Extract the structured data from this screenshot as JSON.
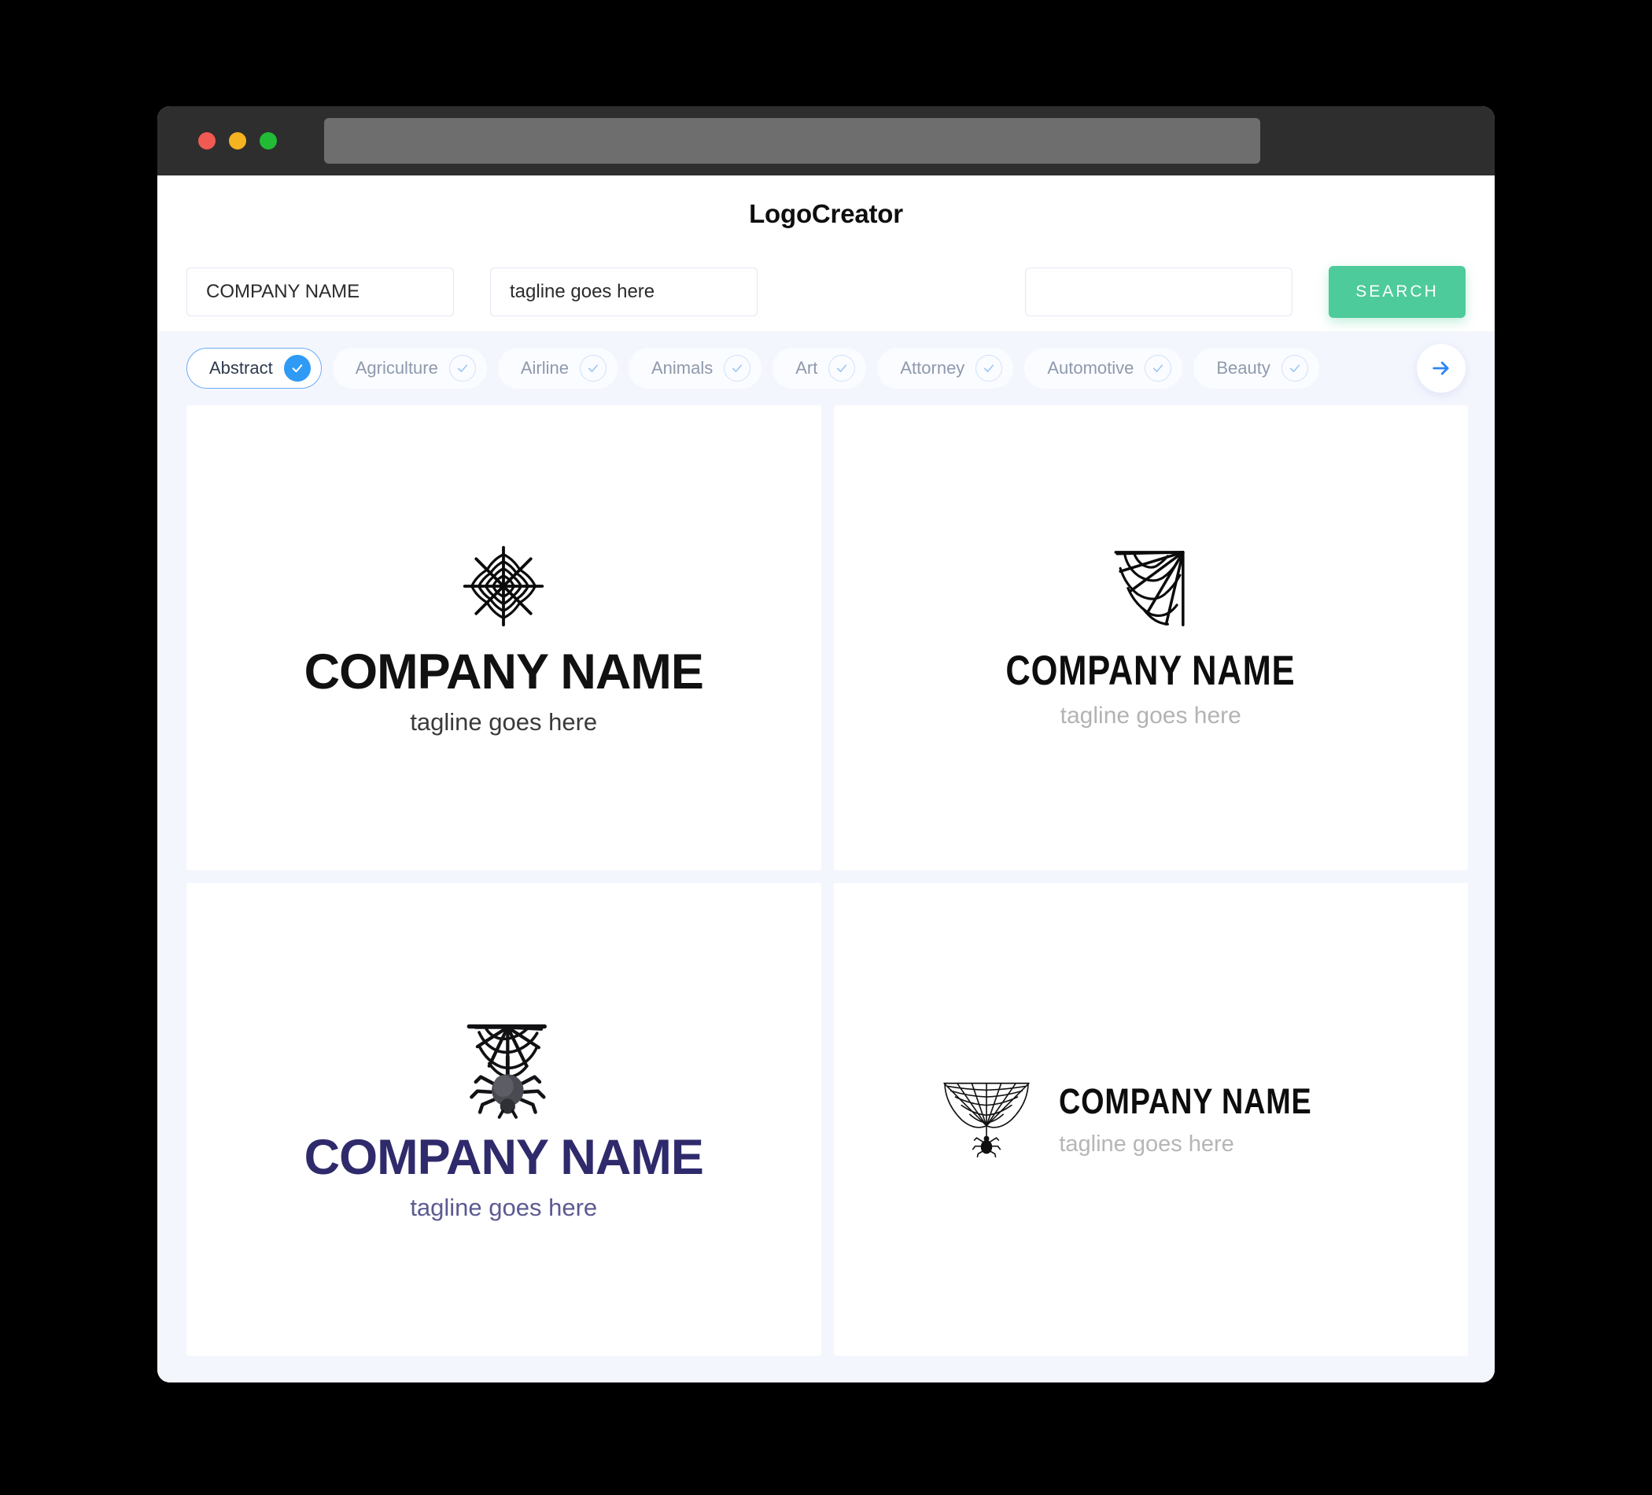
{
  "window": {
    "traffic_lights": [
      "close",
      "minimize",
      "maximize"
    ],
    "colors": {
      "close": "#f05a52",
      "minimize": "#f5b320",
      "maximize": "#22bb36",
      "titlebar": "#2e2e2e",
      "urlbar": "#6e6e6e",
      "page_bg": "#f4f6fe",
      "accent_green": "#4ecb9a",
      "accent_blue": "#2f9bf5",
      "navy": "#2e2a6b"
    }
  },
  "header": {
    "brand": "LogoCreator"
  },
  "search": {
    "company_value": "COMPANY NAME",
    "company_placeholder": "COMPANY NAME",
    "tagline_value": "tagline goes here",
    "tagline_placeholder": "tagline goes here",
    "extra_value": "",
    "extra_placeholder": "",
    "button_label": "SEARCH"
  },
  "categories": {
    "next_icon": "arrow-right-icon",
    "items": [
      {
        "label": "Abstract",
        "selected": true
      },
      {
        "label": "Agriculture",
        "selected": false
      },
      {
        "label": "Airline",
        "selected": false
      },
      {
        "label": "Animals",
        "selected": false
      },
      {
        "label": "Art",
        "selected": false
      },
      {
        "label": "Attorney",
        "selected": false
      },
      {
        "label": "Automotive",
        "selected": false
      },
      {
        "label": "Beauty",
        "selected": false
      }
    ]
  },
  "results": [
    {
      "mark": "spider-web-circular-icon",
      "layout": "stacked",
      "company": "COMPANY NAME",
      "tagline": "tagline goes here",
      "text_color": "#111111",
      "tagline_color": "#3a3a3a"
    },
    {
      "mark": "spider-web-corner-icon",
      "layout": "stacked",
      "company": "COMPANY NAME",
      "tagline": "tagline goes here",
      "text_color": "#0d0d0d",
      "tagline_color": "#b3b3b3"
    },
    {
      "mark": "spider-hanging-web-icon",
      "layout": "stacked",
      "company": "COMPANY NAME",
      "tagline": "tagline goes here",
      "text_color": "#2e2a6b",
      "tagline_color": "#5c5a92"
    },
    {
      "mark": "spider-web-fanline-icon",
      "layout": "horizontal",
      "company": "COMPANY NAME",
      "tagline": "tagline goes here",
      "text_color": "#0d0d0d",
      "tagline_color": "#b6b6b6"
    }
  ]
}
